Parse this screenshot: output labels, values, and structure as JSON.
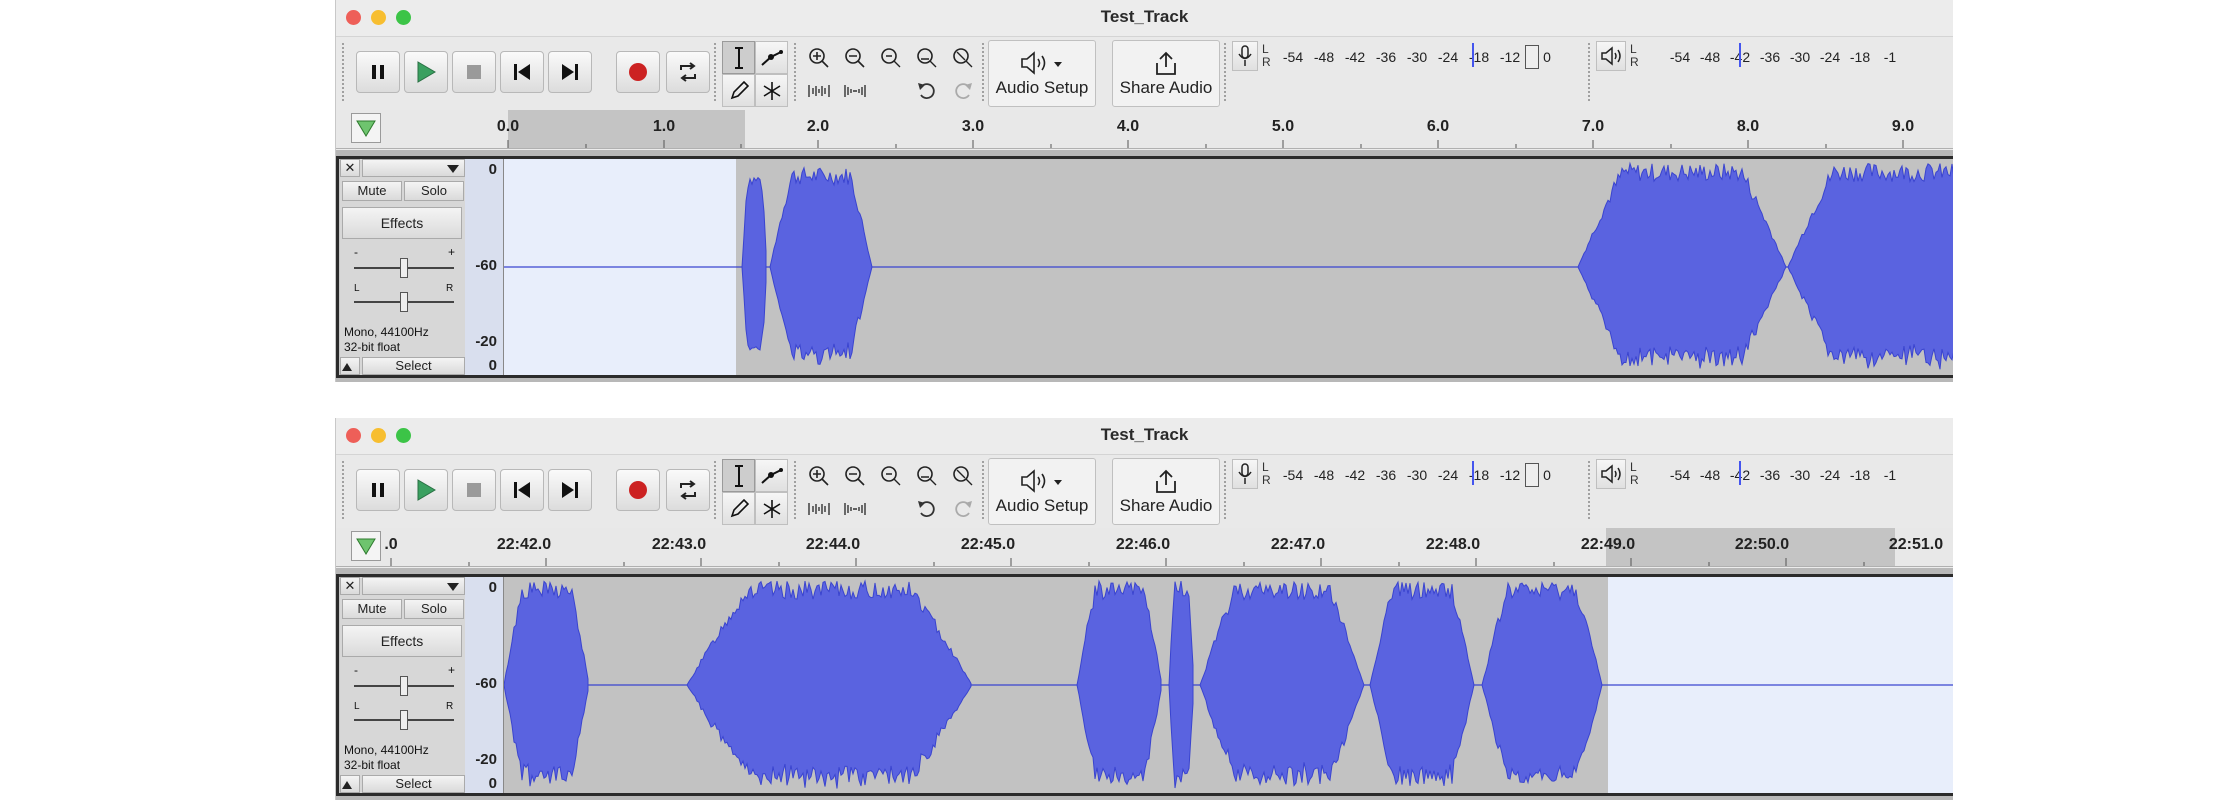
{
  "windows": [
    {
      "title": "Test_Track",
      "toolbar": {
        "audio_setup_label": "Audio Setup",
        "share_audio_label": "Share Audio",
        "record_meter_ticks": [
          "-54",
          "-48",
          "-42",
          "-36",
          "-30",
          "-24",
          "-18",
          "-12"
        ],
        "record_meter_end": "0",
        "play_meter_ticks": [
          "-54",
          "-48",
          "-42",
          "-36",
          "-30",
          "-24",
          "-18",
          "-1"
        ],
        "meter_lr": "L\nR"
      },
      "ruler": {
        "labels": [
          "0.0",
          "1.0",
          "2.0",
          "3.0",
          "4.0",
          "5.0",
          "6.0",
          "7.0",
          "8.0",
          "9.0"
        ]
      },
      "track": {
        "mute_label": "Mute",
        "solo_label": "Solo",
        "effects_label": "Effects",
        "info_rate": "Mono, 44100Hz",
        "info_format": "32-bit float",
        "select_label": "Select",
        "scale": [
          "0",
          "-60",
          "-20",
          "0"
        ],
        "gain_minus": "-",
        "gain_plus": "+",
        "pan_l": "L",
        "pan_r": "R"
      }
    },
    {
      "title": "Test_Track",
      "toolbar": {
        "audio_setup_label": "Audio Setup",
        "share_audio_label": "Share Audio",
        "record_meter_ticks": [
          "-54",
          "-48",
          "-42",
          "-36",
          "-30",
          "-24",
          "-18",
          "-12"
        ],
        "record_meter_end": "0",
        "play_meter_ticks": [
          "-54",
          "-48",
          "-42",
          "-36",
          "-30",
          "-24",
          "-18",
          "-1"
        ],
        "meter_lr": "L\nR"
      },
      "ruler": {
        "labels": [
          ".0",
          "22:42.0",
          "22:43.0",
          "22:44.0",
          "22:45.0",
          "22:46.0",
          "22:47.0",
          "22:48.0",
          "22:49.0",
          "22:50.0",
          "22:51.0"
        ]
      },
      "track": {
        "mute_label": "Mute",
        "solo_label": "Solo",
        "effects_label": "Effects",
        "info_rate": "Mono, 44100Hz",
        "info_format": "32-bit float",
        "select_label": "Select",
        "scale": [
          "0",
          "-60",
          "-20",
          "0"
        ],
        "gain_minus": "-",
        "gain_plus": "+",
        "pan_l": "L",
        "pan_r": "R"
      }
    }
  ],
  "colors": {
    "waveform": "#5a63e0",
    "waveform_edge": "#3a44cf",
    "selection_bg": "#e8eefb",
    "record_red": "#cc2222",
    "play_green": "#3aa060"
  }
}
